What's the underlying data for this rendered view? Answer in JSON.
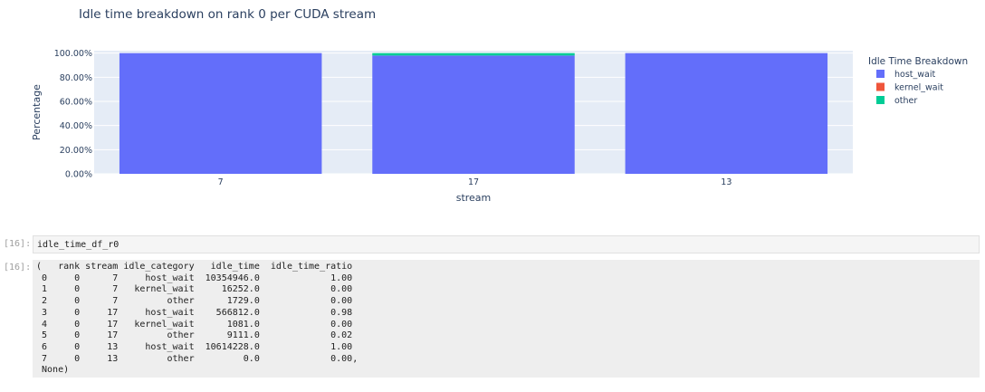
{
  "chart_data": {
    "type": "bar",
    "title": "Idle time breakdown on rank 0 per CUDA stream",
    "xlabel": "stream",
    "ylabel": "Percentage",
    "categories": [
      "7",
      "17",
      "13"
    ],
    "series": [
      {
        "name": "host_wait",
        "values": [
          1.0,
          0.98,
          1.0
        ],
        "color": "#636efa"
      },
      {
        "name": "kernel_wait",
        "values": [
          0.0,
          0.0,
          0.0
        ],
        "color": "#ef553b"
      },
      {
        "name": "other",
        "values": [
          0.0,
          0.02,
          0.0
        ],
        "color": "#00cc96"
      }
    ],
    "yticks": [
      "0.00%",
      "20.00%",
      "40.00%",
      "60.00%",
      "80.00%",
      "100.00%"
    ],
    "ylim": [
      0,
      1.02
    ],
    "stacked": true,
    "grid": true,
    "legend_title": "Idle Time Breakdown",
    "legend_position": "top-right",
    "plot_background": "#e5ecf6"
  },
  "cells": {
    "input_prompt": "[16]:",
    "input_code": "idle_time_df_r0",
    "output_prompt": "[16]:",
    "output_lines": [
      "(   rank stream idle_category   idle_time  idle_time_ratio",
      " 0     0      7     host_wait  10354946.0             1.00",
      " 1     0      7   kernel_wait     16252.0             0.00",
      " 2     0      7         other      1729.0             0.00",
      " 3     0     17     host_wait    566812.0             0.98",
      " 4     0     17   kernel_wait      1081.0             0.00",
      " 5     0     17         other      9111.0             0.02",
      " 6     0     13     host_wait  10614228.0             1.00",
      " 7     0     13         other         0.0             0.00,",
      " None)"
    ]
  }
}
